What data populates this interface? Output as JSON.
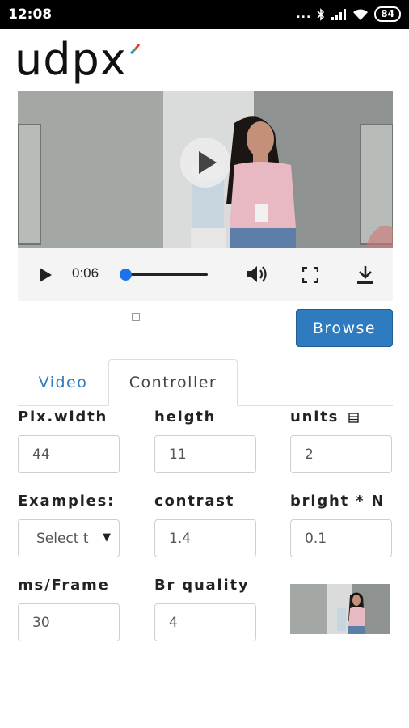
{
  "status_bar": {
    "time": "12:08",
    "dots": "...",
    "battery": "84"
  },
  "app": {
    "logo_text": "udpx"
  },
  "player": {
    "time": "0:06",
    "progress": 0.05
  },
  "buttons": {
    "browse": "Browse"
  },
  "tabs": [
    {
      "label": "Video",
      "active": false
    },
    {
      "label": "Controller",
      "active": true
    }
  ],
  "form": {
    "pix_width": {
      "label": "Pix.width",
      "value": "44"
    },
    "heigth": {
      "label": "heigth",
      "value": "11"
    },
    "units": {
      "label": "units",
      "value": "2"
    },
    "examples": {
      "label": "Examples:",
      "selected": "Select t"
    },
    "contrast": {
      "label": "contrast",
      "value": "1.4"
    },
    "bright": {
      "label": "bright * N",
      "value": "0.1"
    },
    "ms_frame": {
      "label": "ms/Frame",
      "value": "30"
    },
    "br_quality": {
      "label": "Br quality",
      "value": "4"
    }
  },
  "colors": {
    "accent": "#2f7bbf",
    "seek": "#1a73e8"
  },
  "icons": [
    "play-icon",
    "volume-icon",
    "fullscreen-icon",
    "download-icon",
    "signal-icon",
    "wifi-icon",
    "bluetooth-icon",
    "battery-icon",
    "table-icon"
  ]
}
